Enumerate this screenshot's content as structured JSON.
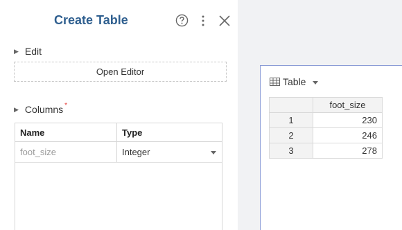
{
  "panel": {
    "title": "Create Table",
    "edit_label": "Edit",
    "open_editor_label": "Open Editor",
    "columns_label": "Columns",
    "required_marker": "*",
    "columns_table": {
      "headers": [
        "Name",
        "Type"
      ],
      "rows": [
        {
          "name": "foot_size",
          "type": "Integer"
        }
      ]
    }
  },
  "icons": {
    "help": "help-circle-icon",
    "more": "more-vertical-icon",
    "close": "close-icon",
    "grid": "table-grid-icon"
  },
  "preview": {
    "view_label": "Table",
    "column_header": "foot_size",
    "rows": [
      {
        "index": "1",
        "value": "230"
      },
      {
        "index": "2",
        "value": "246"
      },
      {
        "index": "3",
        "value": "278"
      }
    ]
  },
  "colors": {
    "title": "#2f5f8f",
    "required": "#e53935",
    "preview_border": "#8a9bd6"
  }
}
